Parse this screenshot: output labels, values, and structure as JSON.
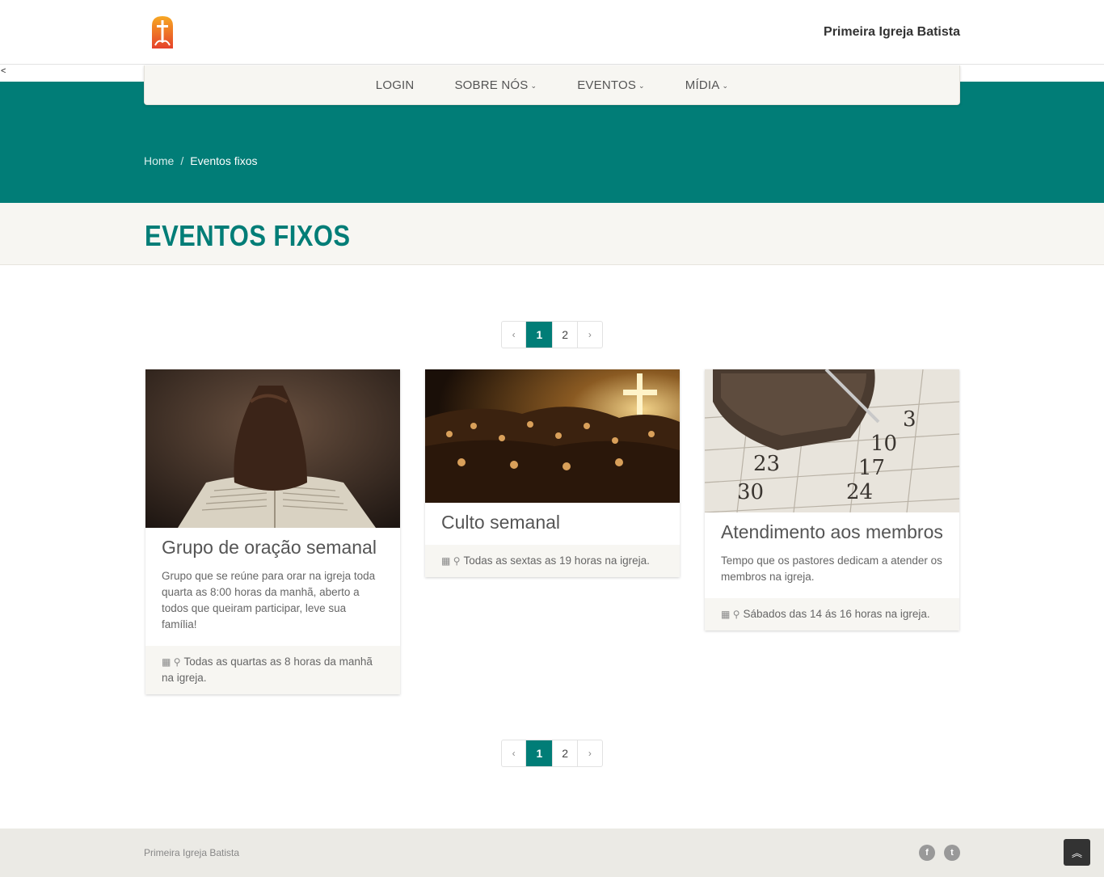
{
  "header": {
    "site_name": "Primeira Igreja Batista",
    "stray_char": "<"
  },
  "nav": {
    "items": [
      {
        "label": "LOGIN",
        "dropdown": false
      },
      {
        "label": "SOBRE NÓS",
        "dropdown": true
      },
      {
        "label": "EVENTOS",
        "dropdown": true
      },
      {
        "label": "MÍDIA",
        "dropdown": true
      }
    ]
  },
  "breadcrumb": {
    "home": "Home",
    "separator": "/",
    "current": "Eventos fixos"
  },
  "page": {
    "title": "EVENTOS FIXOS"
  },
  "pagination": {
    "prev": "‹",
    "pages": [
      "1",
      "2"
    ],
    "active": "1",
    "next": "›"
  },
  "cards": [
    {
      "title": "Grupo de oração semanal",
      "description": "Grupo que se reúne para orar na igreja toda quarta as 8:00 horas da manhã, aberto a todos que queiram participar, leve sua família!",
      "schedule": "Todas as quartas as 8 horas da manhã na igreja."
    },
    {
      "title": "Culto semanal",
      "description": "",
      "schedule": "Todas as sextas as 19 horas na igreja."
    },
    {
      "title": "Atendimento aos membros",
      "description": "Tempo que os pastores dedicam a atender os membros na igreja.",
      "schedule": "Sábados das 14 ás 16 horas na igreja."
    }
  ],
  "footer": {
    "copyright": "Primeira Igreja Batista"
  },
  "colors": {
    "accent": "#017d77",
    "light_bg": "#f7f6f2",
    "footer_bg": "#ebeae5"
  },
  "icons": [
    "church-logo-icon",
    "chevron-down-icon",
    "calendar-icon",
    "map-marker-icon",
    "facebook-icon",
    "twitter-icon",
    "double-chevron-up-icon"
  ]
}
